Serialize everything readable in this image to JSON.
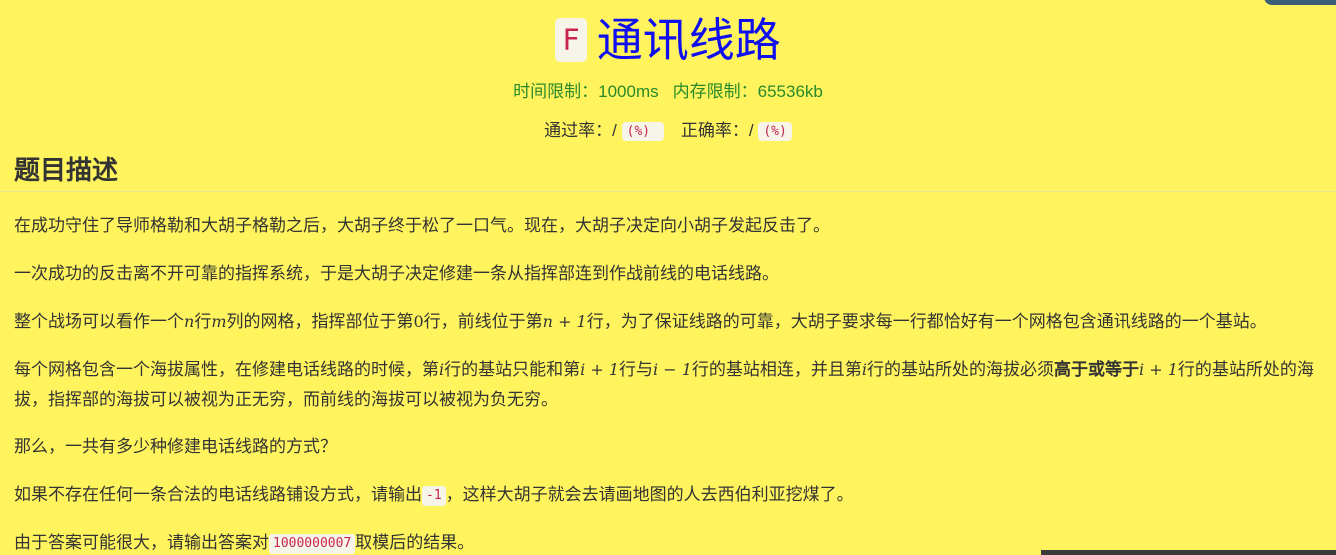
{
  "header": {
    "problem_id": "F",
    "title": "通讯线路"
  },
  "limits": {
    "time": "时间限制：1000ms",
    "memory": "内存限制：65536kb"
  },
  "rates": {
    "pass_label": "通过率：",
    "pass_value": "/",
    "pass_pct": "(%)",
    "accuracy_label": "正确率：",
    "accuracy_value": "/",
    "accuracy_pct": "(%)"
  },
  "section": {
    "title": "题目描述"
  },
  "paragraphs": {
    "p1": "在成功守住了导师格勒和大胡子格勒之后，大胡子终于松了一口气。现在，大胡子决定向小胡子发起反击了。",
    "p2": "一次成功的反击离不开可靠的指挥系统，于是大胡子决定修建一条从指挥部连到作战前线的电话线路。",
    "p3": {
      "t1": "整个战场可以看作一个",
      "n": "n",
      "t2": "行",
      "m": "m",
      "t3": "列的网格，指挥部位于第",
      "zero": "0",
      "t4": "行，前线位于第",
      "n_plus_1": "n + 1",
      "t5": "行，为了保证线路的可靠，大胡子要求每一行都恰好有一个网格包含通讯线路的一个基站。"
    },
    "p4": {
      "t1": "每个网格包含一个海拔属性，在修建电话线路的时候，第",
      "i1": "i",
      "t2": "行的基站只能和第",
      "i_plus_1": "i + 1",
      "t3": "行与",
      "i_minus_1": "i − 1",
      "t4": "行的基站相连，并且第",
      "i2": "i",
      "t5": "行的基站所处的海拔必须",
      "bold": "高于或等于",
      "i_plus_1_b": "i + 1",
      "t6": "行的基站所处的海拔，指挥部的海拔可以被视为正无穷，而前线的海拔可以被视为负无穷。"
    },
    "p5": "那么，一共有多少种修建电话线路的方式？",
    "p6": {
      "t1": "如果不存在任何一条合法的电话线路铺设方式，请输出",
      "code": "-1",
      "t2": "，这样大胡子就会去请画地图的人去西伯利亚挖煤了。"
    },
    "p7": {
      "t1": "由于答案可能很大，请输出答案对",
      "code": "1000000007",
      "t2": "取模后的结果。"
    }
  },
  "colors": {
    "background": "#fff45e",
    "title": "#1010ee",
    "limits": "#2a8a2a",
    "code": "#c8254e"
  }
}
